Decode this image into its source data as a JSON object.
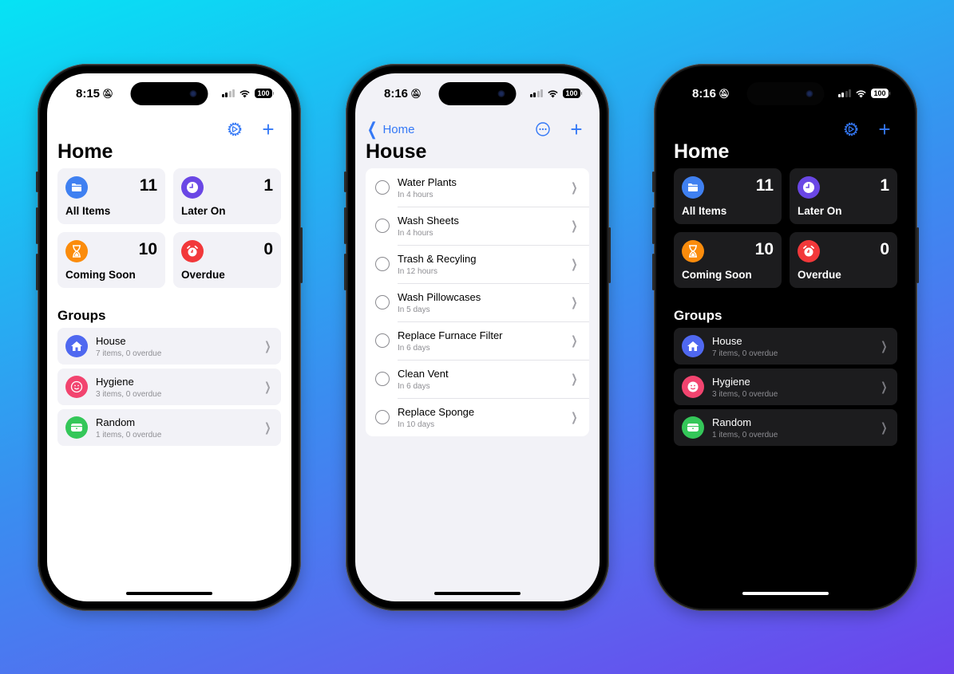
{
  "colors": {
    "accent": "#3478f6",
    "all_items": "#3f80f1",
    "later_on": "#6a47e5",
    "coming_soon": "#fb8c0c",
    "overdue": "#f2383a",
    "house": "#4f68f0",
    "hygiene": "#f2446f",
    "random": "#34c759"
  },
  "phones": [
    {
      "theme": "light",
      "status_bar": {
        "time": "8:15",
        "battery": "100"
      },
      "nav": {
        "settings_icon": "gear-icon",
        "add_icon": "plus-icon"
      },
      "title": "Home",
      "stats": [
        {
          "label": "All Items",
          "count": "11",
          "icon": "folder-icon"
        },
        {
          "label": "Later On",
          "count": "1",
          "icon": "clock-icon"
        },
        {
          "label": "Coming Soon",
          "count": "10",
          "icon": "hourglass-icon"
        },
        {
          "label": "Overdue",
          "count": "0",
          "icon": "alarm-icon"
        }
      ],
      "groups_title": "Groups",
      "groups": [
        {
          "name": "House",
          "subtitle": "7 items, 0 overdue",
          "icon": "house-icon"
        },
        {
          "name": "Hygiene",
          "subtitle": "3 items, 0 overdue",
          "icon": "smiley-icon"
        },
        {
          "name": "Random",
          "subtitle": "1 items, 0 overdue",
          "icon": "tray-icon"
        }
      ]
    },
    {
      "theme": "grouped",
      "status_bar": {
        "time": "8:16",
        "battery": "100"
      },
      "nav": {
        "back_label": "Home",
        "more_icon": "ellipsis-circle-icon",
        "add_icon": "plus-icon"
      },
      "title": "House",
      "tasks": [
        {
          "name": "Water Plants",
          "due": "In 4 hours"
        },
        {
          "name": "Wash Sheets",
          "due": "In 4 hours"
        },
        {
          "name": "Trash & Recyling",
          "due": "In 12 hours"
        },
        {
          "name": "Wash Pillowcases",
          "due": "In 5 days"
        },
        {
          "name": "Replace Furnace Filter",
          "due": "In 6 days"
        },
        {
          "name": "Clean Vent",
          "due": "In 6 days"
        },
        {
          "name": "Replace Sponge",
          "due": "In 10 days"
        }
      ]
    },
    {
      "theme": "dark",
      "status_bar": {
        "time": "8:16",
        "battery": "100"
      },
      "nav": {
        "settings_icon": "gear-icon",
        "add_icon": "plus-icon"
      },
      "title": "Home",
      "stats": [
        {
          "label": "All Items",
          "count": "11",
          "icon": "folder-icon"
        },
        {
          "label": "Later On",
          "count": "1",
          "icon": "clock-icon"
        },
        {
          "label": "Coming Soon",
          "count": "10",
          "icon": "hourglass-icon"
        },
        {
          "label": "Overdue",
          "count": "0",
          "icon": "alarm-icon"
        }
      ],
      "groups_title": "Groups",
      "groups": [
        {
          "name": "House",
          "subtitle": "7 items, 0 overdue",
          "icon": "house-icon"
        },
        {
          "name": "Hygiene",
          "subtitle": "3 items, 0 overdue",
          "icon": "smiley-icon"
        },
        {
          "name": "Random",
          "subtitle": "1 items, 0 overdue",
          "icon": "tray-icon"
        }
      ]
    }
  ]
}
